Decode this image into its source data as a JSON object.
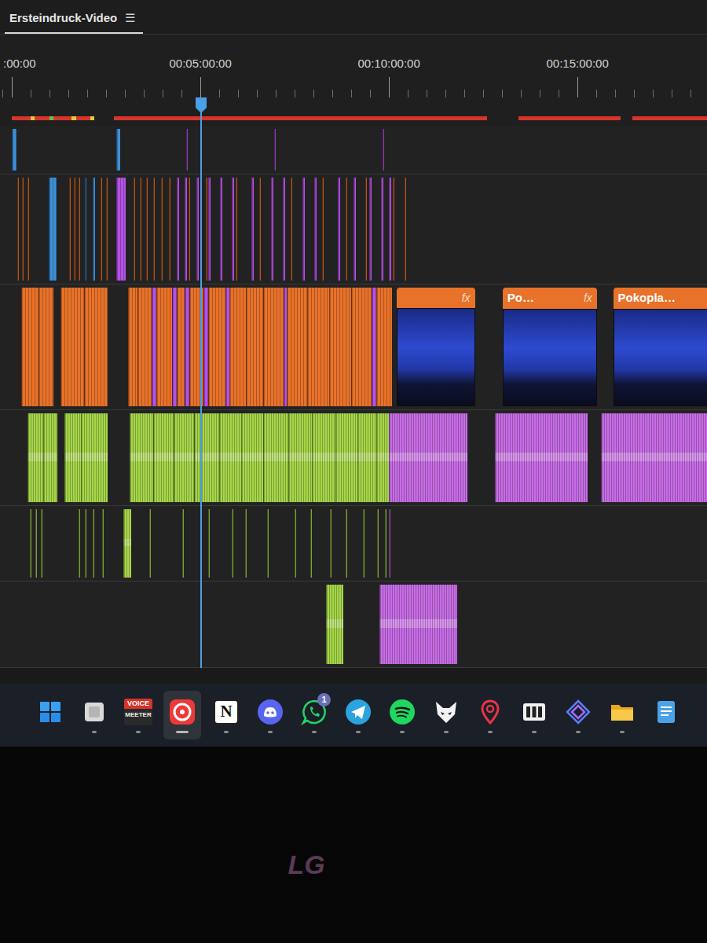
{
  "sequence": {
    "title": "Ersteindruck-Video",
    "menu_icon": "☰",
    "selected": true
  },
  "ruler": {
    "labels": [
      {
        "text": ":00:00",
        "seconds": 0
      },
      {
        "text": "00:05:00:00",
        "seconds": 300
      },
      {
        "text": "00:10:00:00",
        "seconds": 600
      },
      {
        "text": "00:15:00:00",
        "seconds": 900
      }
    ]
  },
  "playhead": {
    "seconds": 300
  },
  "render_bar": [
    {
      "start": 0,
      "end": 30,
      "color": "#d9342b"
    },
    {
      "start": 30,
      "end": 36,
      "color": "#e4c93a"
    },
    {
      "start": 36,
      "end": 60,
      "color": "#d9342b"
    },
    {
      "start": 60,
      "end": 66,
      "color": "#6fbf3f"
    },
    {
      "start": 66,
      "end": 95,
      "color": "#d9342b"
    },
    {
      "start": 95,
      "end": 102,
      "color": "#e4c93a"
    },
    {
      "start": 102,
      "end": 125,
      "color": "#d9342b"
    },
    {
      "start": 125,
      "end": 131,
      "color": "#e4c93a"
    },
    {
      "start": 162,
      "end": 756,
      "color": "#d9342b"
    },
    {
      "start": 806,
      "end": 969,
      "color": "#d9342b"
    },
    {
      "start": 988,
      "end": 1150,
      "color": "#d9342b"
    }
  ],
  "tracks": [
    {
      "clips": [
        {
          "start": 0,
          "end": 8,
          "color": "#3d8fd8",
          "kind": "block"
        },
        {
          "start": 166,
          "end": 172,
          "color": "#3d8fd8",
          "kind": "block"
        },
        {
          "start": 277,
          "end": 279,
          "color": "#b552e6",
          "kind": "block"
        },
        {
          "start": 418,
          "end": 420,
          "color": "#b552e6",
          "kind": "block"
        },
        {
          "start": 590,
          "end": 592,
          "color": "#b552e6",
          "kind": "block"
        }
      ]
    },
    {
      "clips": [
        {
          "start": 9,
          "end": 11,
          "color": "#e8722a",
          "kind": "block"
        },
        {
          "start": 16,
          "end": 18,
          "color": "#e8722a",
          "kind": "block"
        },
        {
          "start": 25,
          "end": 27,
          "color": "#e8722a",
          "kind": "block"
        },
        {
          "start": 59,
          "end": 71,
          "color": "#3d8fd8",
          "kind": "block"
        },
        {
          "start": 91,
          "end": 93,
          "color": "#e8722a",
          "kind": "block"
        },
        {
          "start": 99,
          "end": 101,
          "color": "#e8722a",
          "kind": "block"
        },
        {
          "start": 106,
          "end": 108,
          "color": "#e8722a",
          "kind": "block"
        },
        {
          "start": 116,
          "end": 119,
          "color": "#3d8fd8",
          "kind": "block"
        },
        {
          "start": 129,
          "end": 132,
          "color": "#3d8fd8",
          "kind": "block"
        },
        {
          "start": 141,
          "end": 143,
          "color": "#e8722a",
          "kind": "block"
        },
        {
          "start": 150,
          "end": 152,
          "color": "#e8722a",
          "kind": "block"
        },
        {
          "start": 166,
          "end": 181,
          "color": "#b552e6",
          "kind": "block"
        },
        {
          "start": 194,
          "end": 196,
          "color": "#e8722a",
          "kind": "block"
        },
        {
          "start": 204,
          "end": 206,
          "color": "#e8722a",
          "kind": "block"
        },
        {
          "start": 214,
          "end": 216,
          "color": "#e8722a",
          "kind": "block"
        },
        {
          "start": 225,
          "end": 227,
          "color": "#e8722a",
          "kind": "block"
        },
        {
          "start": 238,
          "end": 240,
          "color": "#e8722a",
          "kind": "block"
        },
        {
          "start": 250,
          "end": 252,
          "color": "#e8722a",
          "kind": "block"
        },
        {
          "start": 262,
          "end": 266,
          "color": "#b552e6",
          "kind": "block"
        },
        {
          "start": 275,
          "end": 279,
          "color": "#b552e6",
          "kind": "block"
        },
        {
          "start": 281,
          "end": 283,
          "color": "#e8722a",
          "kind": "block"
        },
        {
          "start": 294,
          "end": 298,
          "color": "#b552e6",
          "kind": "block"
        },
        {
          "start": 309,
          "end": 311,
          "color": "#e8722a",
          "kind": "block"
        },
        {
          "start": 312,
          "end": 316,
          "color": "#b552e6",
          "kind": "block"
        },
        {
          "start": 331,
          "end": 335,
          "color": "#b552e6",
          "kind": "block"
        },
        {
          "start": 350,
          "end": 354,
          "color": "#b552e6",
          "kind": "block"
        },
        {
          "start": 356,
          "end": 358,
          "color": "#e8722a",
          "kind": "block"
        },
        {
          "start": 381,
          "end": 385,
          "color": "#b552e6",
          "kind": "block"
        },
        {
          "start": 394,
          "end": 396,
          "color": "#e8722a",
          "kind": "block"
        },
        {
          "start": 412,
          "end": 416,
          "color": "#b552e6",
          "kind": "block"
        },
        {
          "start": 431,
          "end": 435,
          "color": "#b552e6",
          "kind": "block"
        },
        {
          "start": 444,
          "end": 446,
          "color": "#e8722a",
          "kind": "block"
        },
        {
          "start": 462,
          "end": 466,
          "color": "#b552e6",
          "kind": "block"
        },
        {
          "start": 481,
          "end": 485,
          "color": "#b552e6",
          "kind": "block"
        },
        {
          "start": 494,
          "end": 496,
          "color": "#e8722a",
          "kind": "block"
        },
        {
          "start": 519,
          "end": 523,
          "color": "#b552e6",
          "kind": "block"
        },
        {
          "start": 531,
          "end": 533,
          "color": "#e8722a",
          "kind": "block"
        },
        {
          "start": 544,
          "end": 548,
          "color": "#b552e6",
          "kind": "block"
        },
        {
          "start": 562,
          "end": 564,
          "color": "#e8722a",
          "kind": "block"
        },
        {
          "start": 569,
          "end": 573,
          "color": "#b552e6",
          "kind": "block"
        },
        {
          "start": 587,
          "end": 591,
          "color": "#b552e6",
          "kind": "block"
        },
        {
          "start": 600,
          "end": 604,
          "color": "#b552e6",
          "kind": "block"
        },
        {
          "start": 606,
          "end": 608,
          "color": "#e8722a",
          "kind": "block"
        },
        {
          "start": 625,
          "end": 627,
          "color": "#e8722a",
          "kind": "block"
        }
      ]
    },
    {
      "clips": [
        {
          "start": 15,
          "end": 42,
          "color": "#e8722a",
          "kind": "block"
        },
        {
          "start": 42,
          "end": 66,
          "color": "#e8722a",
          "kind": "block"
        },
        {
          "start": 78,
          "end": 115,
          "color": "#e8722a",
          "kind": "block"
        },
        {
          "start": 115,
          "end": 152,
          "color": "#e8722a",
          "kind": "block"
        },
        {
          "start": 185,
          "end": 200,
          "color": "#e8722a",
          "kind": "block"
        },
        {
          "start": 200,
          "end": 222,
          "color": "#e8722a",
          "kind": "block"
        },
        {
          "start": 222,
          "end": 230,
          "color": "#b552e6",
          "kind": "block"
        },
        {
          "start": 230,
          "end": 255,
          "color": "#e8722a",
          "kind": "block"
        },
        {
          "start": 255,
          "end": 262,
          "color": "#b552e6",
          "kind": "block"
        },
        {
          "start": 262,
          "end": 275,
          "color": "#e8722a",
          "kind": "block"
        },
        {
          "start": 275,
          "end": 282,
          "color": "#b552e6",
          "kind": "block"
        },
        {
          "start": 282,
          "end": 305,
          "color": "#e8722a",
          "kind": "block"
        },
        {
          "start": 305,
          "end": 312,
          "color": "#b552e6",
          "kind": "block"
        },
        {
          "start": 312,
          "end": 340,
          "color": "#e8722a",
          "kind": "block"
        },
        {
          "start": 340,
          "end": 346,
          "color": "#b552e6",
          "kind": "block"
        },
        {
          "start": 346,
          "end": 372,
          "color": "#e8722a",
          "kind": "block"
        },
        {
          "start": 372,
          "end": 400,
          "color": "#e8722a",
          "kind": "block"
        },
        {
          "start": 400,
          "end": 432,
          "color": "#e8722a",
          "kind": "block"
        },
        {
          "start": 432,
          "end": 438,
          "color": "#b552e6",
          "kind": "block"
        },
        {
          "start": 438,
          "end": 470,
          "color": "#e8722a",
          "kind": "block"
        },
        {
          "start": 470,
          "end": 505,
          "color": "#e8722a",
          "kind": "block"
        },
        {
          "start": 505,
          "end": 540,
          "color": "#e8722a",
          "kind": "block"
        },
        {
          "start": 540,
          "end": 572,
          "color": "#e8722a",
          "kind": "block"
        },
        {
          "start": 572,
          "end": 580,
          "color": "#b552e6",
          "kind": "block"
        },
        {
          "start": 580,
          "end": 605,
          "color": "#e8722a",
          "kind": "block"
        },
        {
          "start": 612,
          "end": 737,
          "color": "#e8722a",
          "kind": "thumb",
          "badge": "fx"
        },
        {
          "start": 781,
          "end": 931,
          "color": "#e8722a",
          "kind": "thumb",
          "label": "Po…",
          "badge": "fx"
        },
        {
          "start": 957,
          "end": 1150,
          "color": "#e8722a",
          "kind": "thumb",
          "label": "Pokopla…"
        }
      ]
    },
    {
      "clips": [
        {
          "start": 25,
          "end": 50,
          "color": "#a6d64a",
          "kind": "wave"
        },
        {
          "start": 50,
          "end": 72,
          "color": "#a6d64a",
          "kind": "wave"
        },
        {
          "start": 84,
          "end": 110,
          "color": "#a6d64a",
          "kind": "wave"
        },
        {
          "start": 110,
          "end": 152,
          "color": "#a6d64a",
          "kind": "wave"
        },
        {
          "start": 188,
          "end": 225,
          "color": "#a6d64a",
          "kind": "wave"
        },
        {
          "start": 225,
          "end": 258,
          "color": "#a6d64a",
          "kind": "wave"
        },
        {
          "start": 258,
          "end": 290,
          "color": "#a6d64a",
          "kind": "wave"
        },
        {
          "start": 290,
          "end": 330,
          "color": "#a6d64a",
          "kind": "wave"
        },
        {
          "start": 330,
          "end": 365,
          "color": "#a6d64a",
          "kind": "wave"
        },
        {
          "start": 365,
          "end": 400,
          "color": "#a6d64a",
          "kind": "wave"
        },
        {
          "start": 400,
          "end": 440,
          "color": "#a6d64a",
          "kind": "wave"
        },
        {
          "start": 440,
          "end": 478,
          "color": "#a6d64a",
          "kind": "wave"
        },
        {
          "start": 478,
          "end": 515,
          "color": "#a6d64a",
          "kind": "wave"
        },
        {
          "start": 515,
          "end": 550,
          "color": "#a6d64a",
          "kind": "wave"
        },
        {
          "start": 550,
          "end": 580,
          "color": "#a6d64a",
          "kind": "wave"
        },
        {
          "start": 580,
          "end": 600,
          "color": "#a6d64a",
          "kind": "wave"
        },
        {
          "start": 600,
          "end": 725,
          "color": "#c96bea",
          "kind": "wave"
        },
        {
          "start": 769,
          "end": 916,
          "color": "#c96bea",
          "kind": "wave"
        },
        {
          "start": 937,
          "end": 1150,
          "color": "#c96bea",
          "kind": "wave"
        }
      ]
    },
    {
      "clips": [
        {
          "start": 29,
          "end": 31,
          "color": "#a6d64a",
          "kind": "block"
        },
        {
          "start": 38,
          "end": 40,
          "color": "#a6d64a",
          "kind": "block"
        },
        {
          "start": 46,
          "end": 48,
          "color": "#a6d64a",
          "kind": "block"
        },
        {
          "start": 106,
          "end": 108,
          "color": "#a6d64a",
          "kind": "block"
        },
        {
          "start": 116,
          "end": 118,
          "color": "#a6d64a",
          "kind": "block"
        },
        {
          "start": 129,
          "end": 131,
          "color": "#a6d64a",
          "kind": "block"
        },
        {
          "start": 144,
          "end": 146,
          "color": "#a6d64a",
          "kind": "block"
        },
        {
          "start": 178,
          "end": 190,
          "color": "#a6d64a",
          "kind": "wave"
        },
        {
          "start": 219,
          "end": 221,
          "color": "#a6d64a",
          "kind": "block"
        },
        {
          "start": 271,
          "end": 273,
          "color": "#a6d64a",
          "kind": "block"
        },
        {
          "start": 312,
          "end": 314,
          "color": "#a6d64a",
          "kind": "block"
        },
        {
          "start": 350,
          "end": 352,
          "color": "#a6d64a",
          "kind": "block"
        },
        {
          "start": 371,
          "end": 373,
          "color": "#a6d64a",
          "kind": "block"
        },
        {
          "start": 406,
          "end": 408,
          "color": "#a6d64a",
          "kind": "block"
        },
        {
          "start": 450,
          "end": 452,
          "color": "#a6d64a",
          "kind": "block"
        },
        {
          "start": 475,
          "end": 477,
          "color": "#a6d64a",
          "kind": "block"
        },
        {
          "start": 506,
          "end": 508,
          "color": "#a6d64a",
          "kind": "block"
        },
        {
          "start": 531,
          "end": 533,
          "color": "#a6d64a",
          "kind": "block"
        },
        {
          "start": 559,
          "end": 561,
          "color": "#a6d64a",
          "kind": "block"
        },
        {
          "start": 581,
          "end": 583,
          "color": "#a6d64a",
          "kind": "block"
        },
        {
          "start": 594,
          "end": 596,
          "color": "#a6d64a",
          "kind": "block"
        },
        {
          "start": 600,
          "end": 602,
          "color": "#c96bea",
          "kind": "block"
        }
      ]
    },
    {
      "clips": [
        {
          "start": 500,
          "end": 528,
          "color": "#a6d64a",
          "kind": "wave"
        },
        {
          "start": 585,
          "end": 709,
          "color": "#c96bea",
          "kind": "wave"
        }
      ]
    }
  ],
  "taskbar": {
    "items": [
      {
        "kind": "start",
        "running": false,
        "selected": false,
        "texts": []
      },
      {
        "kind": "widget",
        "running": true,
        "selected": false,
        "texts": []
      },
      {
        "kind": "voicemeeter",
        "running": true,
        "selected": false,
        "texts": [
          "VOICE",
          "MEETER"
        ]
      },
      {
        "kind": "vivaldi",
        "running": true,
        "selected": true,
        "texts": []
      },
      {
        "kind": "notion",
        "running": true,
        "selected": false,
        "texts": [
          "N"
        ]
      },
      {
        "kind": "discord",
        "running": true,
        "selected": false,
        "texts": []
      },
      {
        "kind": "whatsapp",
        "running": true,
        "selected": false,
        "texts": [],
        "badge": "1"
      },
      {
        "kind": "telegram",
        "running": true,
        "selected": false,
        "texts": []
      },
      {
        "kind": "spotify",
        "running": true,
        "selected": false,
        "texts": []
      },
      {
        "kind": "fox",
        "running": true,
        "selected": false,
        "texts": []
      },
      {
        "kind": "pin",
        "running": true,
        "selected": false,
        "texts": []
      },
      {
        "kind": "deck",
        "running": true,
        "selected": false,
        "texts": []
      },
      {
        "kind": "prism",
        "running": true,
        "selected": false,
        "texts": []
      },
      {
        "kind": "folder",
        "running": true,
        "selected": false,
        "texts": []
      },
      {
        "kind": "notepad",
        "running": false,
        "selected": false,
        "texts": []
      }
    ]
  },
  "monitor": {
    "brand": "LG"
  }
}
